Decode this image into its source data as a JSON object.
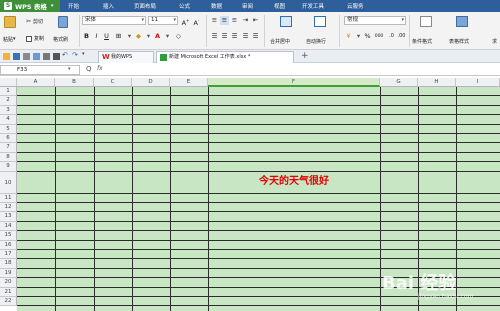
{
  "app": {
    "name": "WPS 表格",
    "logo_letter": "S"
  },
  "menu": {
    "items": [
      "开始",
      "插入",
      "页面布局",
      "公式",
      "数据",
      "审阅",
      "视图",
      "开发工具",
      "云服务"
    ]
  },
  "ribbon": {
    "paste_label": "粘贴",
    "cut_label": "剪切",
    "copy_label": "复制",
    "format_painter_label": "格式刷",
    "font_name": "宋体",
    "font_size": "11",
    "bold": "B",
    "italic": "I",
    "underline": "U",
    "merge_center_label": "合并居中",
    "wrap_label": "自动换行",
    "number_format": "常规",
    "percent": "%",
    "comma": "000",
    "conditional_format_label": "条件格式",
    "table_style_label": "表格样式",
    "extra_label": "求"
  },
  "doc_tabs": [
    {
      "label": "我的WPS",
      "active": false
    },
    {
      "label": "新建 Microsoft Excel 工作表.xlsx *",
      "active": true
    }
  ],
  "new_tab_symbol": "+",
  "formula_bar": {
    "cell_ref": "F33",
    "zoom_symbol": "Q",
    "fx": "fx",
    "value": ""
  },
  "grid": {
    "columns": [
      "A",
      "B",
      "C",
      "D",
      "E",
      "F",
      "G",
      "H",
      "I"
    ],
    "active_column": "F",
    "rows": [
      "1",
      "2",
      "3",
      "4",
      "5",
      "6",
      "7",
      "8",
      "9",
      "10",
      "11",
      "12",
      "13",
      "14",
      "15",
      "16",
      "17",
      "18",
      "19",
      "20",
      "21",
      "22"
    ],
    "cell_text": "今天的天气很好",
    "cell_text_location": "F10",
    "cell_text_color": "#e00000",
    "fill_color": "#c8e6c4"
  },
  "watermark": {
    "text": "Bai 经验",
    "sub": "jingyan.baidu.com"
  }
}
